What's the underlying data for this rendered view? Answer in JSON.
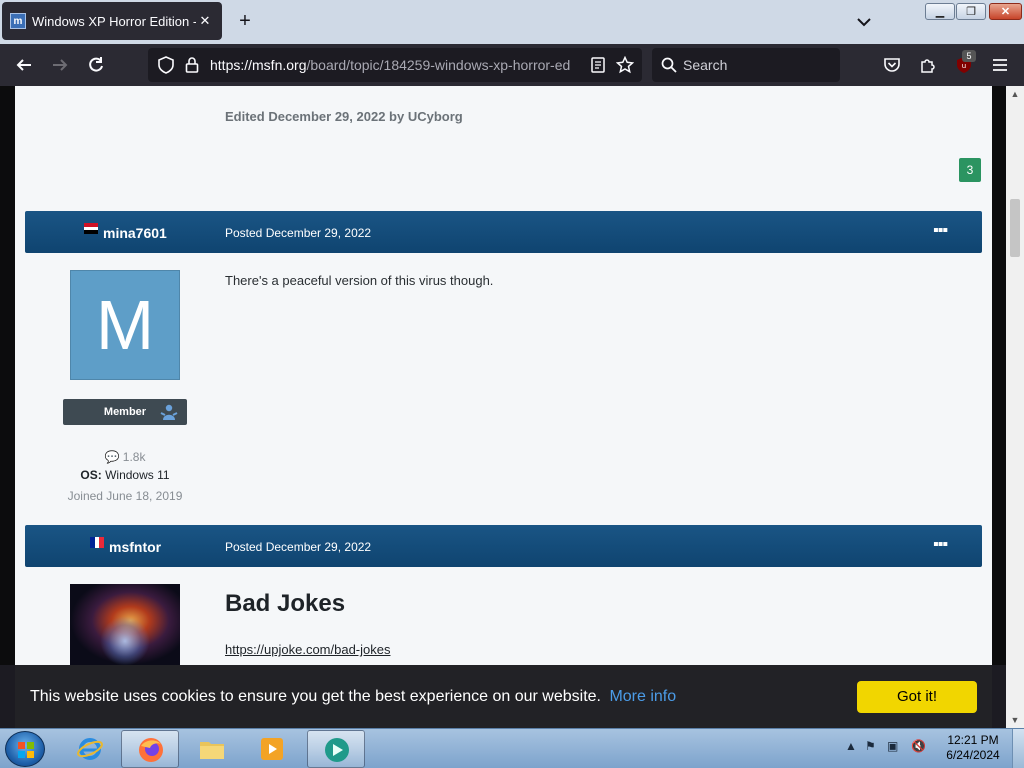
{
  "browser": {
    "tab_title": "Windows XP Horror Edition - M",
    "tab_favicon_text": "m",
    "url_host": "https://msfn.org",
    "url_path": "/board/topic/184259-windows-xp-horror-ed",
    "search_placeholder": "Search",
    "extension_badge": "5"
  },
  "page": {
    "edited_note": "Edited December 29, 2022 by UCyborg",
    "reaction_count": "3",
    "posts": [
      {
        "author": "mina7601",
        "posted": "Posted December 29, 2022",
        "avatar_letter": "M",
        "rank": "Member",
        "post_count": "1.8k",
        "os_label": "OS:",
        "os_value": "Windows 11",
        "joined": "Joined June 18, 2019",
        "body": "There's a peaceful version of this virus though."
      },
      {
        "author": "msfntor",
        "posted": "Posted December 29, 2022",
        "heading": "Bad Jokes",
        "link": "https://upjoke.com/bad-jokes"
      }
    ]
  },
  "cookie_banner": {
    "message": "This website uses cookies to ensure you get the best experience on our website.",
    "more_info": "More info",
    "accept": "Got it!"
  },
  "taskbar": {
    "time": "12:21 PM",
    "date": "6/24/2024"
  },
  "colors": {
    "post_header": "#0f4470",
    "reaction_badge": "#2b9461",
    "cookie_button": "#f1d600",
    "link": "#4b9ce8"
  }
}
